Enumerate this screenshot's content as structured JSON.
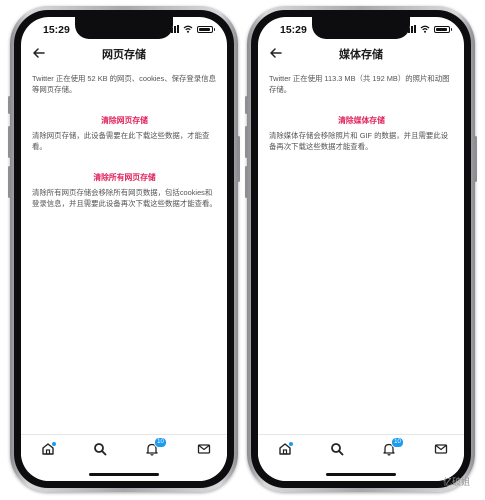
{
  "colors": {
    "accent_red": "#e0245e",
    "badge_blue": "#1d9bf0",
    "text_gray": "#555555"
  },
  "left_phone": {
    "status": {
      "time": "15:29"
    },
    "nav": {
      "back_icon": "arrow-left-icon",
      "title": "网页存储"
    },
    "description": "Twitter 正在使用 52 KB 的网页、cookies、保存登录信息等网页存储。",
    "actions": [
      {
        "label": "清除网页存储",
        "note": "清除网页存储，此设备需要在此下载这些数据，才能查看。"
      },
      {
        "label": "清除所有网页存储",
        "note": "清除所有网页存储会移除所有网页数据，包括cookies和登录信息，并且需要此设备再次下载这些数据才能查看。"
      }
    ],
    "tabbar": {
      "notification_badge": "10",
      "icons": [
        "home-icon",
        "search-icon",
        "bell-icon",
        "mail-icon"
      ]
    }
  },
  "right_phone": {
    "status": {
      "time": "15:29"
    },
    "nav": {
      "back_icon": "arrow-left-icon",
      "title": "媒体存储"
    },
    "description": "Twitter 正在使用 113.3 MB（共 192 MB）的照片和动图存储。",
    "actions": [
      {
        "label": "清除媒体存储",
        "note": "清除媒体存储会移除照片和 GIF 的数据，并且需要此设备再次下载这些数据才能查看。"
      }
    ],
    "tabbar": {
      "notification_badge": "10",
      "icons": [
        "home-icon",
        "search-icon",
        "bell-icon",
        "mail-icon"
      ]
    }
  },
  "watermark": "亿破姐"
}
